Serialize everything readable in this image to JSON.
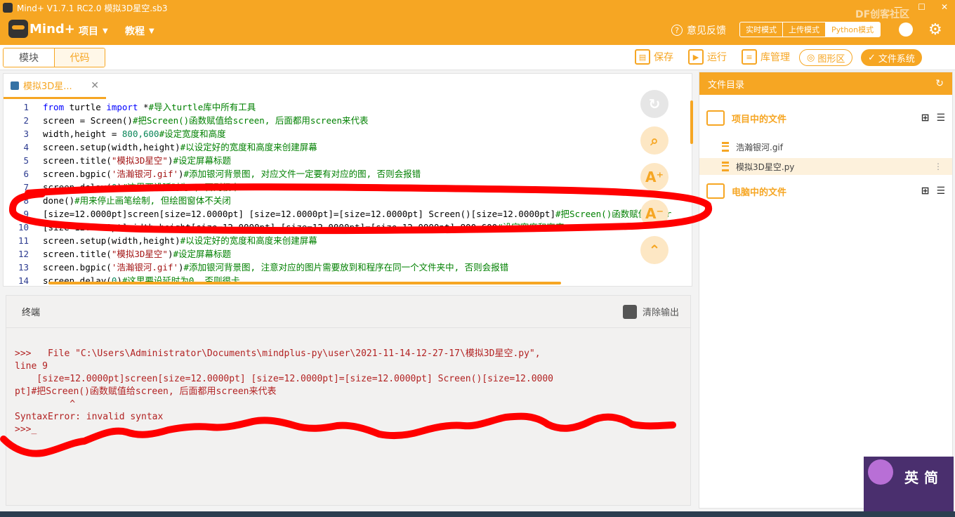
{
  "window": {
    "title": "Mind+ V1.7.1 RC2.0    模拟3D星空.sb3"
  },
  "topbar": {
    "logo_text": "Mind+",
    "menu_project": "项目",
    "menu_tutorial": "教程",
    "feedback": "意见反馈",
    "modes": [
      "实时模式",
      "上传模式",
      "Python模式"
    ],
    "watermark": "DF创客社区"
  },
  "toolbar": {
    "tab_blocks": "模块",
    "tab_code": "代码",
    "save": "保存",
    "run": "运行",
    "library": "库管理",
    "graphics": "图形区",
    "filesystem": "文件系统"
  },
  "editor": {
    "file_tab": "模拟3D星...",
    "lines": [
      {
        "n": "1",
        "kw": "from",
        "mid": " turtle ",
        "kw2": "import",
        "rest": " *",
        "cmt": "#导入turtle库中所有工具"
      },
      {
        "n": "2",
        "code": "screen = Screen()",
        "cmt": "#把Screen()函数赋值给screen, 后面都用screen来代表"
      },
      {
        "n": "3",
        "code": "width,height = ",
        "num": "800,600",
        "cmt": "#设定宽度和高度"
      },
      {
        "n": "4",
        "code": "screen.setup(width,height)",
        "cmt": "#以设定好的宽度和高度来创建屏幕"
      },
      {
        "n": "5",
        "code": "screen.title(",
        "str": "\"模拟3D星空\"",
        "code2": ")",
        "cmt": "#设定屏幕标题"
      },
      {
        "n": "6",
        "code": "screen.bgpic(",
        "str": "'浩瀚银河.gif'",
        "code2": ")",
        "cmt": "#添加银河背景图, 对应文件一定要有对应的图, 否则会报错"
      },
      {
        "n": "7",
        "code": "screen.delay(",
        "num": "0",
        "code2": ")",
        "cmt": "#这里要设延时为0, 否则很卡"
      },
      {
        "n": "8",
        "code": "done()",
        "cmt": "#用来停止画笔绘制, 但绘图窗体不关闭"
      },
      {
        "n": "9",
        "code": "[size=12.0000pt]screen[size=12.0000pt] [size=12.0000pt]=[size=12.0000pt] Screen()[size=12.0000pt]",
        "cmt": "#把Screen()函数赋值给scr"
      },
      {
        "n": "10",
        "code": "[size=12.0000pt]width,height[size=12.0000pt] [size=12.0000pt]=[size=12.0000pt] 800,600",
        "cmt": "#设定宽度和高度"
      },
      {
        "n": "11",
        "code": "screen.setup(width,height)",
        "cmt": "#以设定好的宽度和高度来创建屏幕"
      },
      {
        "n": "12",
        "code": "screen.title(",
        "str": "\"模拟3D星空\"",
        "code2": ")",
        "cmt": "#设定屏幕标题"
      },
      {
        "n": "13",
        "code": "screen.bgpic(",
        "str": "'浩瀚银河.gif'",
        "code2": ")",
        "cmt": "#添加银河背景图, 注意对应的图片需要放到和程序在同一个文件夹中, 否则会报错"
      },
      {
        "n": "14",
        "code": "screen.delay(",
        "num": "0",
        "code2": ")",
        "cmt": "#这里要设延时为0, 否则很卡"
      }
    ]
  },
  "terminal": {
    "title": "终端",
    "clear": "清除输出",
    "output": ">>>   File \"C:\\Users\\Administrator\\Documents\\mindplus-py\\user\\2021-11-14-12-27-17\\模拟3D星空.py\",\nline 9\n    [size=12.0000pt]screen[size=12.0000pt] [size=12.0000pt]=[size=12.0000pt] Screen()[size=12.0000\npt]#把Screen()函数赋值给screen, 后面都用screen来代表\n          ^\nSyntaxError: invalid syntax\n>>>_"
  },
  "sidebar": {
    "title": "文件目录",
    "project_files": "项目中的文件",
    "files": [
      "浩瀚银河.gif",
      "模拟3D星空.py"
    ],
    "computer_files": "电脑中的文件"
  },
  "ime": {
    "label1": "英",
    "label2": "简"
  },
  "colors": {
    "accent": "#f6a623",
    "annotation": "#ff0000"
  }
}
